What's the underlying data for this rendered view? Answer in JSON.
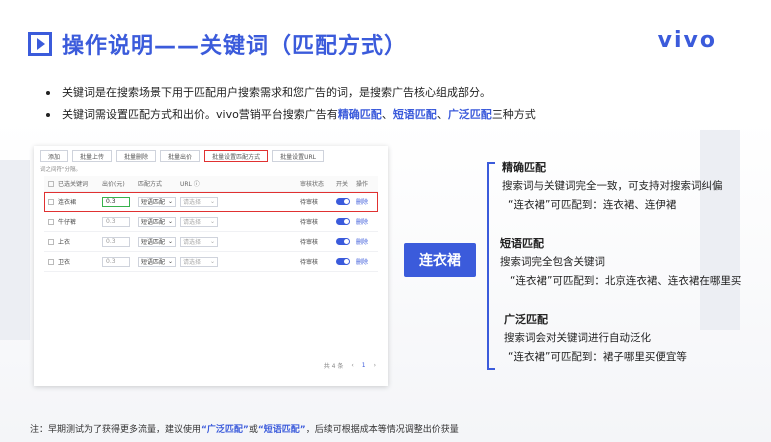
{
  "brand": "vivo",
  "title": "操作说明——关键词（匹配方式）",
  "bullets": [
    {
      "text": "关键词是在搜索场景下用于匹配用户搜索需求和您广告的词，是搜索广告核心组成部分。"
    },
    {
      "prefix": "关键词需设置匹配方式和出价。vivo营销平台搜索广告有",
      "hl1": "精确匹配",
      "sep1": "、",
      "hl2": "短语匹配",
      "sep2": "、",
      "hl3": "广泛匹配",
      "suffix": "三种方式"
    }
  ],
  "toolbar": [
    "添加",
    "批量上传",
    "批量删除",
    "批量出价",
    "批量设置匹配方式",
    "批量设置URL"
  ],
  "hint": "词之间符\"分隔。",
  "table": {
    "headers": [
      "已选关键词",
      "出价(元)",
      "匹配方式",
      "URL ⓘ",
      "审核状态",
      "开关",
      "操作"
    ],
    "rows": [
      {
        "keyword": "连衣裙",
        "bid": "0.3",
        "match": "短语匹配",
        "url": "请选择",
        "status": "待审核",
        "op": "删除"
      },
      {
        "keyword": "牛仔裤",
        "bid": "0.3",
        "match": "短语匹配",
        "url": "请选择",
        "status": "待审核",
        "op": "删除"
      },
      {
        "keyword": "上衣",
        "bid": "0.3",
        "match": "短语匹配",
        "url": "请选择",
        "status": "待审核",
        "op": "删除"
      },
      {
        "keyword": "卫衣",
        "bid": "0.3",
        "match": "短语匹配",
        "url": "请选择",
        "status": "待审核",
        "op": "删除"
      }
    ]
  },
  "pager": {
    "total": "共 4 条",
    "page": "1"
  },
  "keyword_tag": "连衣裙",
  "match_types": [
    {
      "title": "精确匹配",
      "line1": "搜索词与关键词完全一致，可支持对搜索词纠偏",
      "line2": "“连衣裙”可匹配到：连衣裙、连伊裙"
    },
    {
      "title": "短语匹配",
      "line1": "搜索词完全包含关键词",
      "line2": "“连衣裙”可匹配到：北京连衣裙、连衣裙在哪里买"
    },
    {
      "title": "广泛匹配",
      "line1": "搜索词会对关键词进行自动泛化",
      "line2": "“连衣裙”可匹配到：裙子哪里买便宜等"
    }
  ],
  "footnote": {
    "prefix": "注：早期测试为了获得更多流量，建议使用",
    "hl1": "“广泛匹配”",
    "mid": "或",
    "hl2": "“短语匹配”",
    "suffix": "，后续可根据成本等情况调整出价获量"
  },
  "colors": {
    "accent": "#3b5bdb",
    "highlight_border": "#e03131",
    "input_green": "#37b24d"
  }
}
